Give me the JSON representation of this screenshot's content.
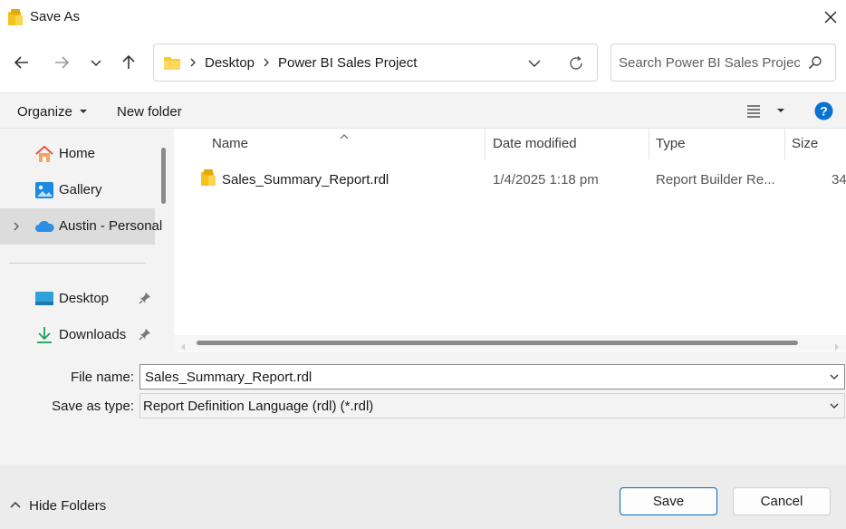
{
  "window": {
    "title": "Save As"
  },
  "address": {
    "crumbs": [
      "Desktop",
      "Power BI Sales Project"
    ]
  },
  "search": {
    "placeholder": "Search Power BI Sales Project"
  },
  "commands": {
    "organize": "Organize",
    "new_folder": "New folder"
  },
  "sidebar": {
    "items": [
      {
        "label": "Home",
        "icon": "home-icon"
      },
      {
        "label": "Gallery",
        "icon": "gallery-icon"
      },
      {
        "label": "Austin - Personal",
        "icon": "onedrive-cloud-icon"
      },
      {
        "label": "Desktop",
        "icon": "desktop-icon"
      },
      {
        "label": "Downloads",
        "icon": "downloads-icon"
      }
    ]
  },
  "filelist": {
    "columns": [
      "Name",
      "Date modified",
      "Type",
      "Size"
    ],
    "rows": [
      {
        "name": "Sales_Summary_Report.rdl",
        "date": "1/4/2025 1:18 pm",
        "type": "Report Builder Re...",
        "size": "34"
      }
    ]
  },
  "form": {
    "file_name_label": "File name:",
    "file_name_value": "Sales_Summary_Report.rdl",
    "save_type_label": "Save as type:",
    "save_type_value": "Report Definition Language (rdl)  (*.rdl)"
  },
  "footer": {
    "hide_folders": "Hide Folders",
    "save": "Save",
    "cancel": "Cancel"
  },
  "colors": {
    "accent": "#0067c0",
    "folder": "#f8c93a",
    "help": "#0a72d1",
    "onedrive": "#2b8fe5"
  }
}
